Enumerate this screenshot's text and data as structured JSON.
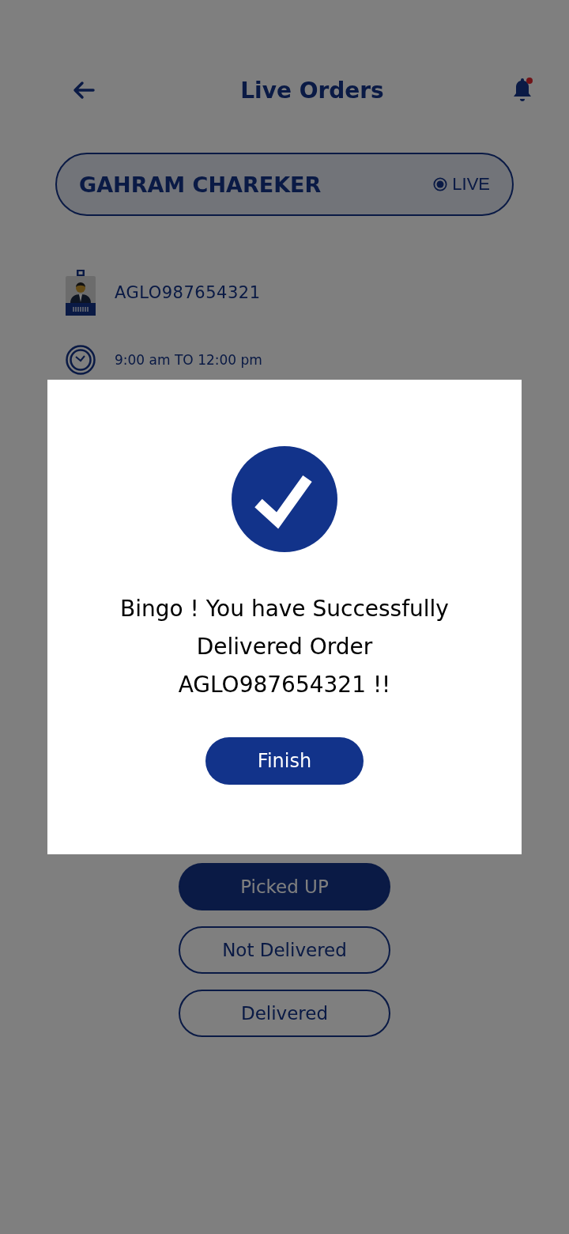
{
  "header": {
    "title": "Live Orders",
    "has_notification": true
  },
  "customer": {
    "name": "GAHRAM CHAREKER",
    "status": "LIVE"
  },
  "order": {
    "id": "AGLO987654321",
    "time_slot": "9:00 am TO 12:00 pm"
  },
  "status_buttons": [
    {
      "label": "Picked UP",
      "selected": true
    },
    {
      "label": "Not Delivered",
      "selected": false
    },
    {
      "label": "Delivered",
      "selected": false
    }
  ],
  "dialog": {
    "message": "Bingo ! You have Successfully Delivered Order AGLO987654321 !!",
    "button": "Finish"
  }
}
